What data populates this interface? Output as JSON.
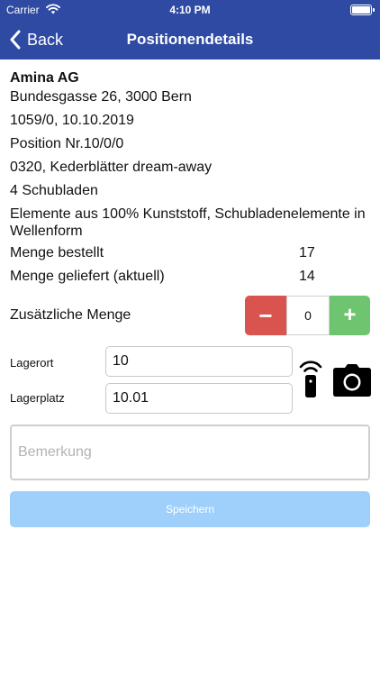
{
  "status_bar": {
    "carrier": "Carrier",
    "time": "4:10 PM"
  },
  "nav": {
    "back_label": "Back",
    "title": "Positionendetails"
  },
  "info": {
    "company": "Amina AG",
    "address": "Bundesgasse 26, 3000 Bern",
    "order": "1059/0, 10.10.2019",
    "position": "Position Nr.10/0/0",
    "article": "0320, Kederblätter dream-away",
    "drawers": "4 Schubladen",
    "description": "Elemente aus 100% Kunststoff, Schubladenelemente in Wellenform"
  },
  "quantities": {
    "ordered_label": "Menge bestellt",
    "ordered_value": "17",
    "delivered_label": "Menge geliefert (aktuell)",
    "delivered_value": "14"
  },
  "stepper": {
    "label": "Zusätzliche Menge",
    "minus": "−",
    "value": "0",
    "plus": "+"
  },
  "fields": {
    "lagerort_label": "Lagerort",
    "lagerort_value": "10",
    "lagerplatz_label": "Lagerplatz",
    "lagerplatz_value": "10.01"
  },
  "remark": {
    "placeholder": "Bemerkung"
  },
  "save": {
    "label": "Speichern"
  },
  "icons": {
    "back": "chevron-left-icon",
    "rfid": "rfid-scanner-icon",
    "camera": "camera-icon",
    "wifi": "wifi-icon",
    "battery": "battery-icon"
  },
  "colors": {
    "nav_bg": "#2e4aa3",
    "minus_btn": "#d9534f",
    "plus_btn": "#6fc46f",
    "save_btn": "#9fd0fb"
  }
}
